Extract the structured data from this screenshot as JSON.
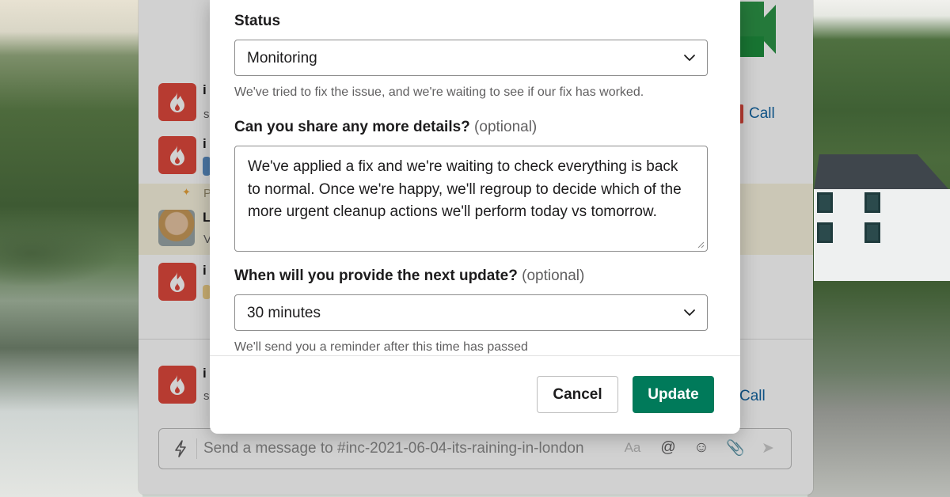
{
  "modal": {
    "status_label": "Status",
    "status_value": "Monitoring",
    "status_hint": "We've tried to fix the issue, and we're waiting to see if our fix has worked.",
    "details_label": "Can you share any more details?",
    "details_optional": "(optional)",
    "details_text": "We've applied a fix and we're waiting to check everything is back to normal. Once we're happy, we'll regroup to decide which of the more urgent cleanup actions we'll perform today vs tomorrow.",
    "next_update_label": "When will you provide the next update?",
    "next_update_optional": "(optional)",
    "next_update_value": "30 minutes",
    "next_update_hint": "We'll send you a reminder after this time has passed",
    "cancel_label": "Cancel",
    "update_label": "Update"
  },
  "background": {
    "message_letters": [
      "i",
      "i",
      "L",
      "i",
      "i"
    ],
    "message_sub_letters": [
      "s",
      "V",
      "s"
    ],
    "pinned_letter": "P",
    "call_label": "Call",
    "composer_placeholder": "Send a message to #inc-2021-06-04-its-raining-in-london",
    "composer_aa": "Aa"
  },
  "colors": {
    "primary_button": "#007a5a",
    "avatar_red": "#e0483c",
    "link_blue": "#1264a3"
  }
}
